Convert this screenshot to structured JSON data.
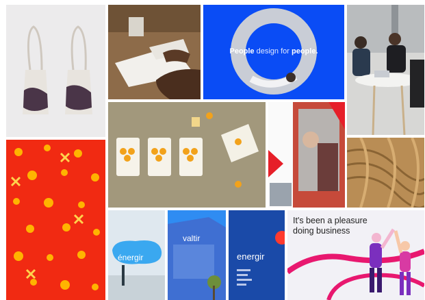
{
  "collage": {
    "tiles": [
      {
        "subject": "tote-bags",
        "colors": {
          "bg": "#ecebec",
          "bag": "#e8e4de",
          "print": "#4a3548"
        }
      },
      {
        "subject": "desk-sketching",
        "colors": {
          "desk": "#8d6b49"
        }
      },
      {
        "subject": "blue-poster",
        "colors": {
          "bg": "#0a4cf5"
        }
      },
      {
        "subject": "team-meeting",
        "colors": {
          "bg": "#d7d7d5"
        }
      },
      {
        "subject": "packaging",
        "colors": {
          "bg": "#a2987c",
          "accent": "#f2a21b"
        }
      },
      {
        "subject": "printed-brochure",
        "colors": {
          "accent": "#e61f29"
        }
      },
      {
        "subject": "wood-texture",
        "colors": {
          "bg": "#b98d55"
        }
      },
      {
        "subject": "red-pattern",
        "colors": {
          "bg": "#f12a12",
          "pattern": "#ffb400"
        }
      },
      {
        "subject": "energir-signage-1",
        "colors": {
          "sky": "#dfe8ef",
          "bubble": "#3aa8f0"
        }
      },
      {
        "subject": "energir-building",
        "colors": {
          "bg": "#2f8cf2"
        }
      },
      {
        "subject": "energir-poster",
        "colors": {
          "bg": "#1a4aa8"
        }
      },
      {
        "subject": "people-illustration",
        "colors": {
          "bg": "#f2f1f6",
          "loop": "#e8186f",
          "people": "#7b2fbe"
        }
      }
    ],
    "blue_poster": {
      "text_bold_1": "People",
      "text_light": "design for",
      "text_bold_2": "people."
    },
    "energir_1": {
      "text": "énergir"
    },
    "energir_2": {
      "text": "valtir"
    },
    "energir_3": {
      "text": "energir"
    },
    "business": {
      "line1": "It's been a pleasure",
      "line2": "doing business"
    }
  }
}
